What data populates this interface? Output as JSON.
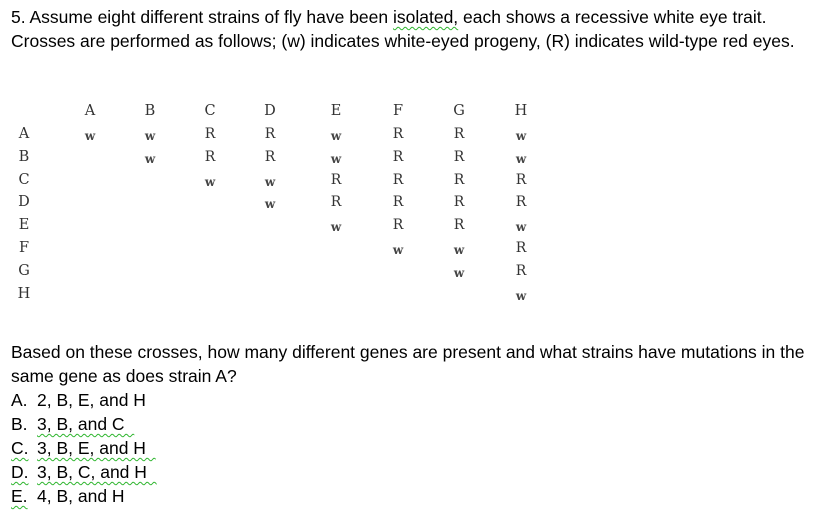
{
  "intro": {
    "prefix": "5.  Assume eight different strains of fly have been ",
    "flagged_word": "isolated,",
    "suffix": " each shows a recessive white eye trait. Crosses are performed as follows; (w) indicates white-eyed progeny, (R) indicates wild-type red eyes."
  },
  "table": {
    "columns": [
      "A",
      "B",
      "C",
      "D",
      "E",
      "F",
      "G",
      "H"
    ],
    "rows": [
      {
        "label": "A",
        "cells": [
          "w",
          "w",
          "R",
          "R",
          "w",
          "R",
          "R",
          "w"
        ]
      },
      {
        "label": "B",
        "cells": [
          "",
          "w",
          "R",
          "R",
          "w",
          "R",
          "R",
          "w"
        ]
      },
      {
        "label": "C",
        "cells": [
          "",
          "",
          "w",
          "w",
          "R",
          "R",
          "R",
          "R"
        ]
      },
      {
        "label": "D",
        "cells": [
          "",
          "",
          "",
          "w",
          "R",
          "R",
          "R",
          "R"
        ]
      },
      {
        "label": "E",
        "cells": [
          "",
          "",
          "",
          "",
          "w",
          "R",
          "R",
          "w"
        ]
      },
      {
        "label": "F",
        "cells": [
          "",
          "",
          "",
          "",
          "",
          "w",
          "w",
          "R"
        ]
      },
      {
        "label": "G",
        "cells": [
          "",
          "",
          "",
          "",
          "",
          "",
          "w",
          "R"
        ]
      },
      {
        "label": "H",
        "cells": [
          "",
          "",
          "",
          "",
          "",
          "",
          "",
          "w"
        ]
      }
    ]
  },
  "question": {
    "text": "Based on these crosses, how many different genes are present and what strains have mutations in the same gene as does strain A?"
  },
  "options": [
    {
      "letter": "A.",
      "text": "2, B, E, and H",
      "flag_letter": false,
      "flag_text": false
    },
    {
      "letter": "B.",
      "text": "3, B, and C",
      "flag_letter": false,
      "flag_text": true
    },
    {
      "letter": "C.",
      "text": "3, B, E, and H",
      "flag_letter": true,
      "flag_text": true
    },
    {
      "letter": "D.",
      "text": "3, B, C, and H",
      "flag_letter": true,
      "flag_text": true
    },
    {
      "letter": "E.",
      "text": "4, B, and H",
      "flag_letter": true,
      "flag_text": false
    }
  ]
}
